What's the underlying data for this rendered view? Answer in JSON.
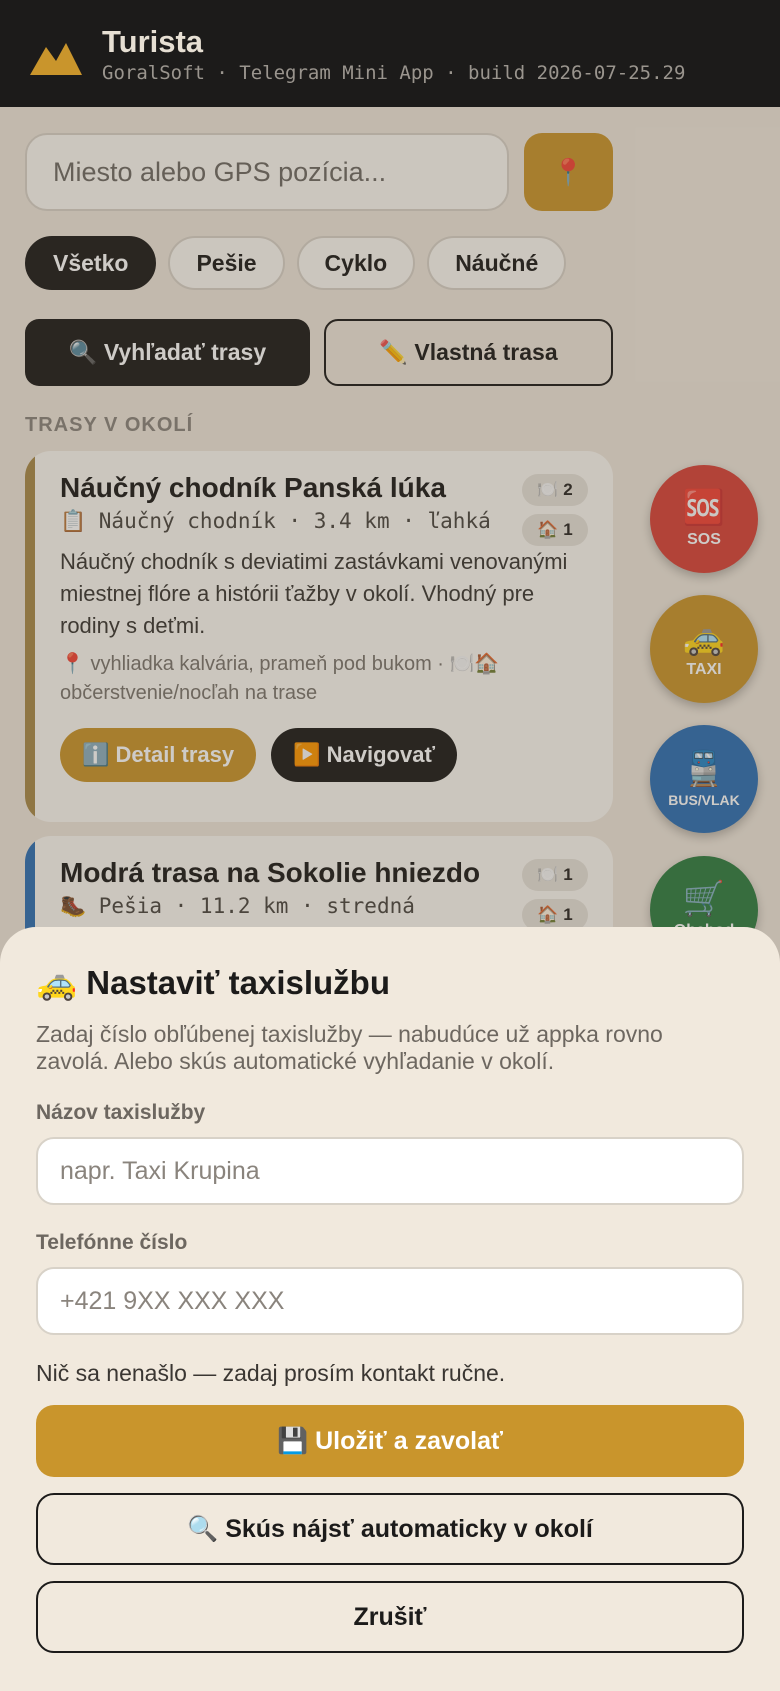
{
  "header": {
    "title": "Turista",
    "subtitle": "GoralSoft · Telegram Mini App · build 2026-07-25.29",
    "logo_icon": "mountains-logo-icon",
    "logo_color": "#c9952c"
  },
  "search": {
    "placeholder": "Miesto alebo GPS pozícia...",
    "gps_icon": "📍"
  },
  "filters": [
    {
      "label": "Všetko",
      "active": true
    },
    {
      "label": "Pešie",
      "active": false
    },
    {
      "label": "Cyklo",
      "active": false
    },
    {
      "label": "Náučné",
      "active": false
    }
  ],
  "actions": {
    "search_label": "🔍 Vyhľadať trasy",
    "custom_label": "✏️ Vlastná trasa"
  },
  "section_label": "TRASY V OKOLÍ",
  "routes": [
    {
      "title": "Náučný chodník Panská lúka",
      "meta": "📋 Náučný chodník · 3.4 km · ľahká",
      "desc": "Náučný chodník s deviatimi zastávkami venovanými miestnej flóre a histórii ťažby v okolí. Vhodný pre rodiny s deťmi.",
      "poi": "📍 vyhliadka kalvária, prameň pod bukom · 🍽️🏠 občerstvenie/nocľah na trase",
      "badge_food": "🍽️ 2",
      "badge_home": "🏠 1",
      "detail_label": "ℹ️ Detail trasy",
      "nav_label": "▶️ Navigovať",
      "strip_color": "#a88a4a"
    },
    {
      "title": "Modrá trasa na Sokolie hniezdo",
      "meta": "🥾 Pešia · 11.2 km · stredná",
      "badge_food": "🍽️ 1",
      "badge_home": "🏠 1",
      "strip_color": "#2d6fb5"
    }
  ],
  "fabs": [
    {
      "icon": "🆘",
      "label": "SOS",
      "color": "#d9433a"
    },
    {
      "icon": "🚕",
      "label": "TAXI",
      "color": "#c9952c"
    },
    {
      "icon": "🚆",
      "label": "BUS/VLAK",
      "color": "#2d6fb5"
    },
    {
      "icon": "🛒",
      "label": "Obchod",
      "color": "#2f7d42"
    }
  ],
  "sheet": {
    "title": "🚕 Nastaviť taxislužbu",
    "desc": "Zadaj číslo obľúbenej taxislužby — nabudúce už appka rovno zavolá. Alebo skús automatické vyhľadanie v okolí.",
    "name_label": "Názov taxislužby",
    "name_placeholder": "napr. Taxi Krupina",
    "phone_label": "Telefónne číslo",
    "phone_placeholder": "+421 9XX XXX XXX",
    "status": "Nič sa nenašlo — zadaj prosím kontakt ručne.",
    "save_label": "💾 Uložiť a zavolať",
    "auto_label": "🔍 Skús nájsť automaticky v okolí",
    "cancel_label": "Zrušiť"
  }
}
